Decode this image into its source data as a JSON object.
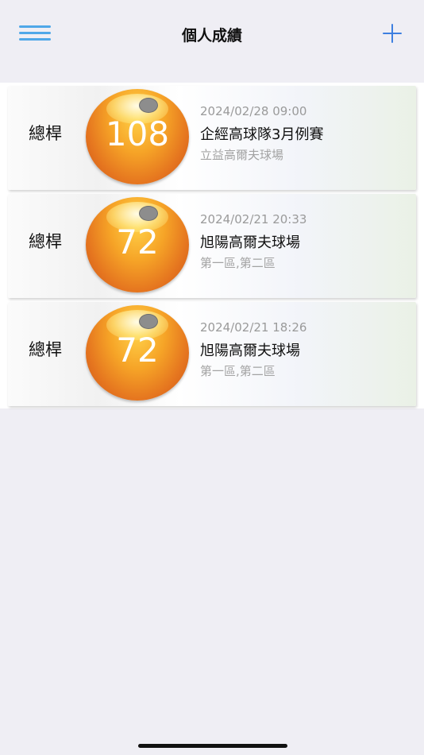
{
  "nav": {
    "title": "個人成績"
  },
  "rounds": [
    {
      "label": "總桿",
      "score": "108",
      "datetime": "2024/02/28 09:00",
      "event": "企經高球隊3月例賽",
      "course": "立益高爾夫球場"
    },
    {
      "label": "總桿",
      "score": "72",
      "datetime": "2024/02/21 20:33",
      "event": "旭陽高爾夫球場",
      "course": "第一區,第二區"
    },
    {
      "label": "總桿",
      "score": "72",
      "datetime": "2024/02/21 18:26",
      "event": "旭陽高爾夫球場",
      "course": "第一區,第二區"
    }
  ],
  "colors": {
    "accent": "#3d7fe0",
    "menu": "#4fa7e8",
    "ball": "#f6a427"
  },
  "icons": {
    "menu": "hamburger-icon",
    "add": "plus-icon"
  }
}
